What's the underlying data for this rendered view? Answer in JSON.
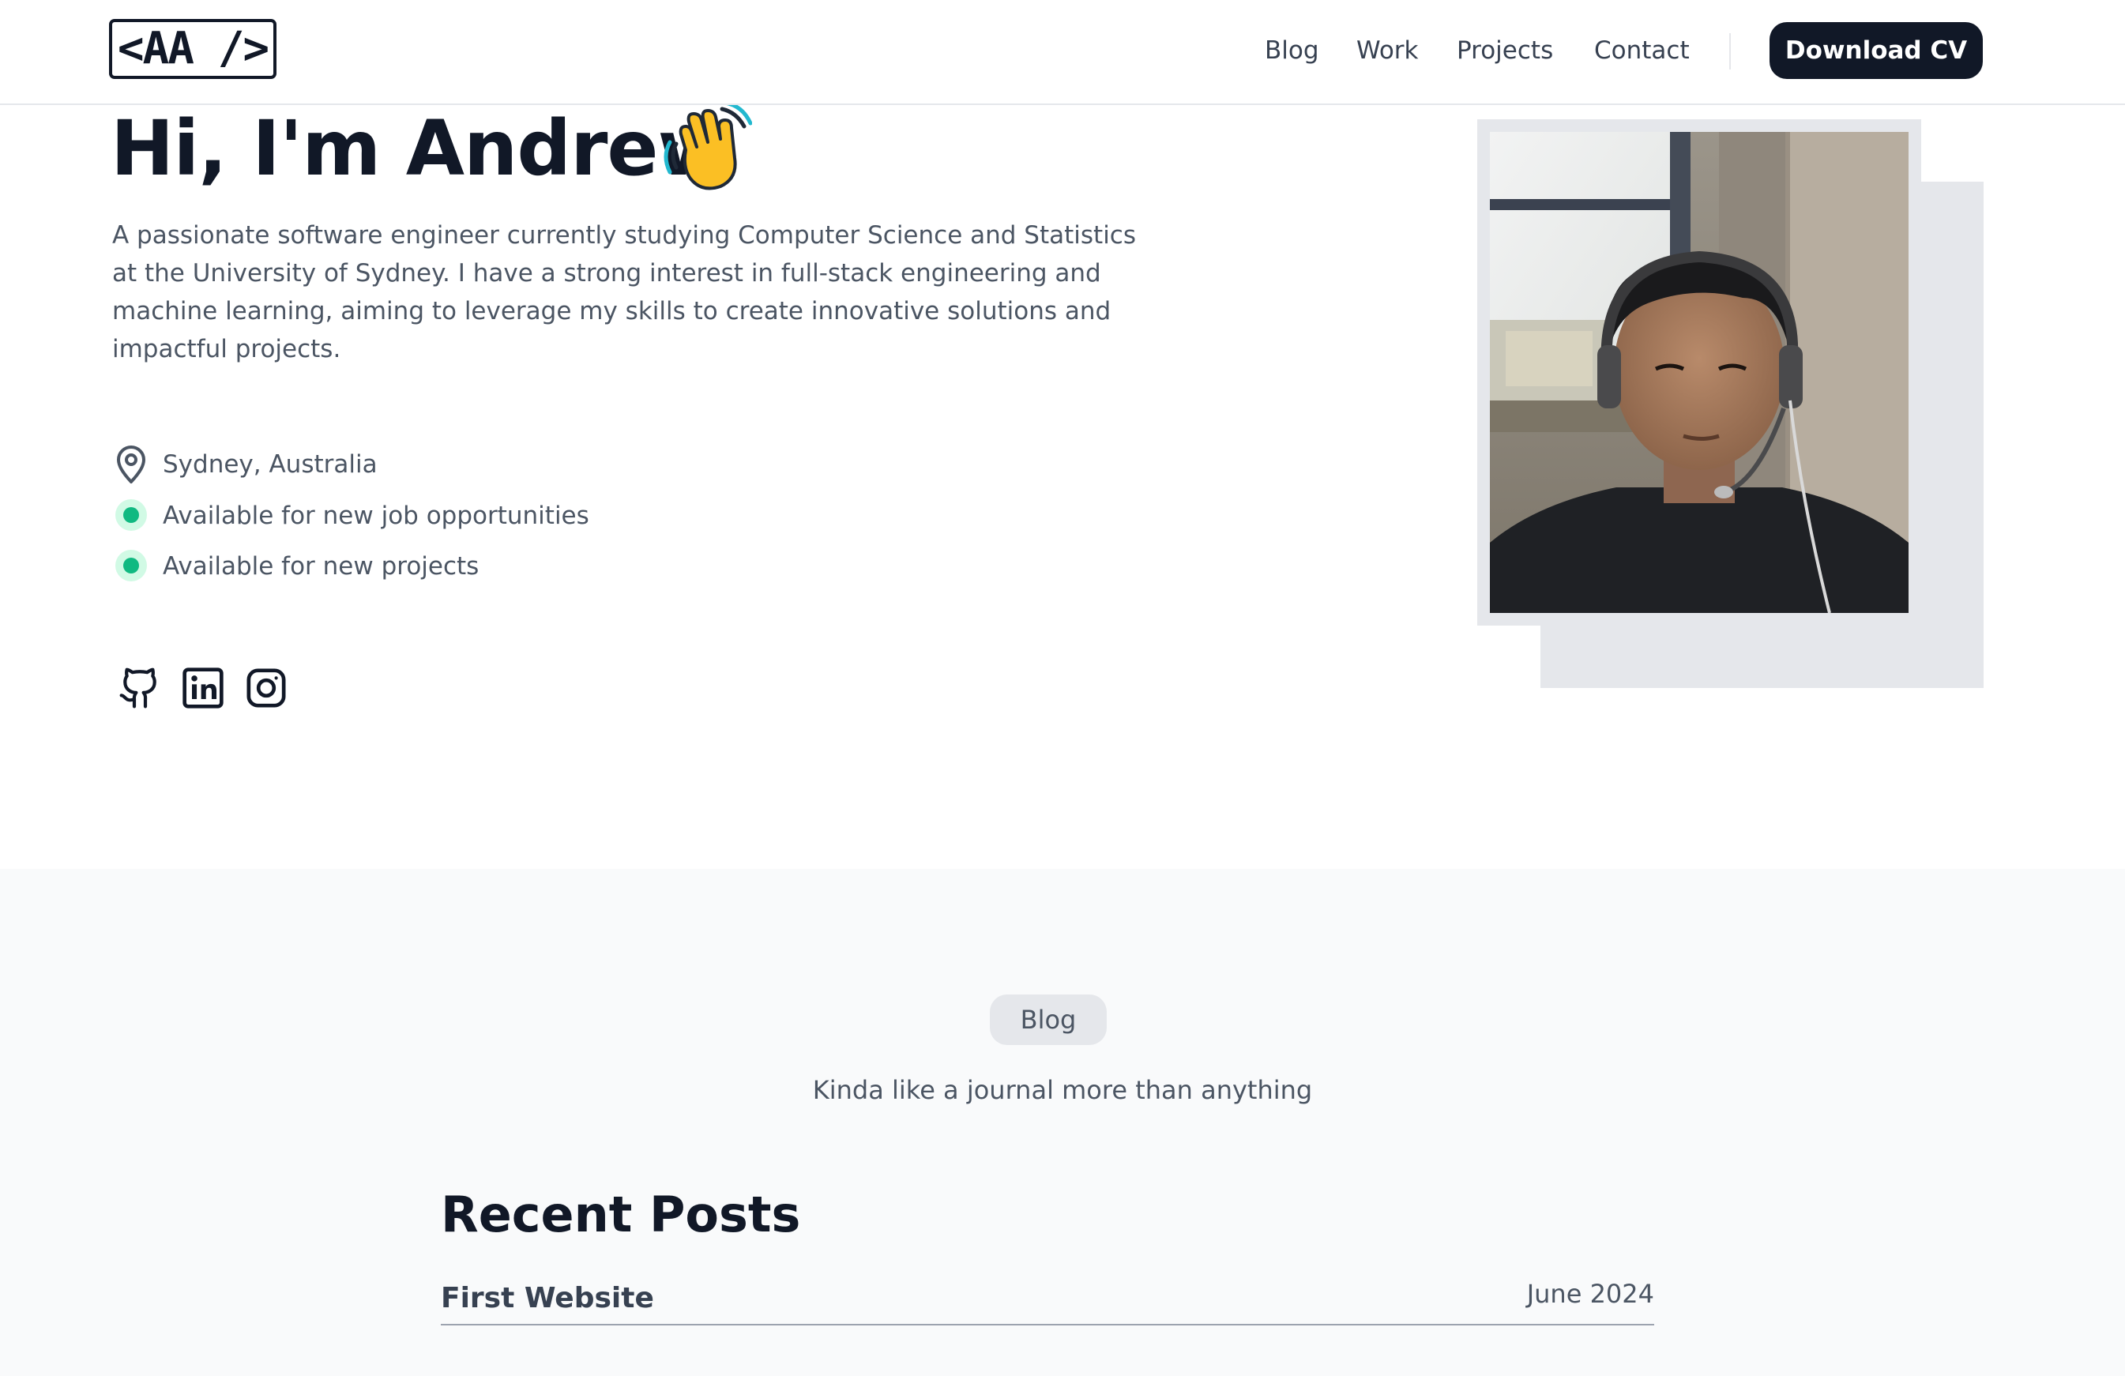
{
  "header": {
    "logo_text": "<AA />",
    "nav": [
      {
        "label": "Blog"
      },
      {
        "label": "Work"
      },
      {
        "label": "Projects"
      },
      {
        "label": "Contact"
      }
    ],
    "cv_button_label": "Download CV"
  },
  "hero": {
    "title": "Hi, I'm Andrew",
    "emoji_icon": "waving-hand-icon",
    "description": "A passionate software engineer currently studying Computer Science and Statistics at the University of Sydney. I have a strong interest in full-stack engineering and machine learning, aiming to leverage my skills to create innovative solutions and impactful projects.",
    "location": "Sydney, Australia",
    "statuses": [
      "Available for new job opportunities",
      "Available for new projects"
    ],
    "status_color": "#10b981",
    "socials": [
      "github-icon",
      "linkedin-icon",
      "instagram-icon"
    ]
  },
  "blog": {
    "badge": "Blog",
    "subtitle": "Kinda like a journal more than anything",
    "recent_title": "Recent Posts",
    "posts": [
      {
        "title": "First Website",
        "date": "June 2024"
      }
    ]
  },
  "colors": {
    "text_dark": "#111827",
    "text_muted": "#4b5563",
    "section_bg": "#f9fafb",
    "accent_button": "#111827"
  }
}
